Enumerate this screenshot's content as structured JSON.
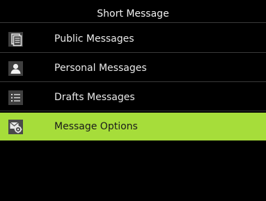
{
  "header": {
    "title": "Short Message"
  },
  "menu": {
    "items": [
      {
        "label": "Public Messages",
        "icon": "document-icon",
        "selected": false
      },
      {
        "label": "Personal Messages",
        "icon": "person-icon",
        "selected": false
      },
      {
        "label": "Drafts Messages",
        "icon": "list-icon",
        "selected": false
      },
      {
        "label": "Message Options",
        "icon": "message-settings-icon",
        "selected": true
      }
    ]
  },
  "colors": {
    "background": "#000000",
    "selected_highlight": "#a6dd3a",
    "divider": "#3a3a3a",
    "text": "#eaeaea"
  }
}
